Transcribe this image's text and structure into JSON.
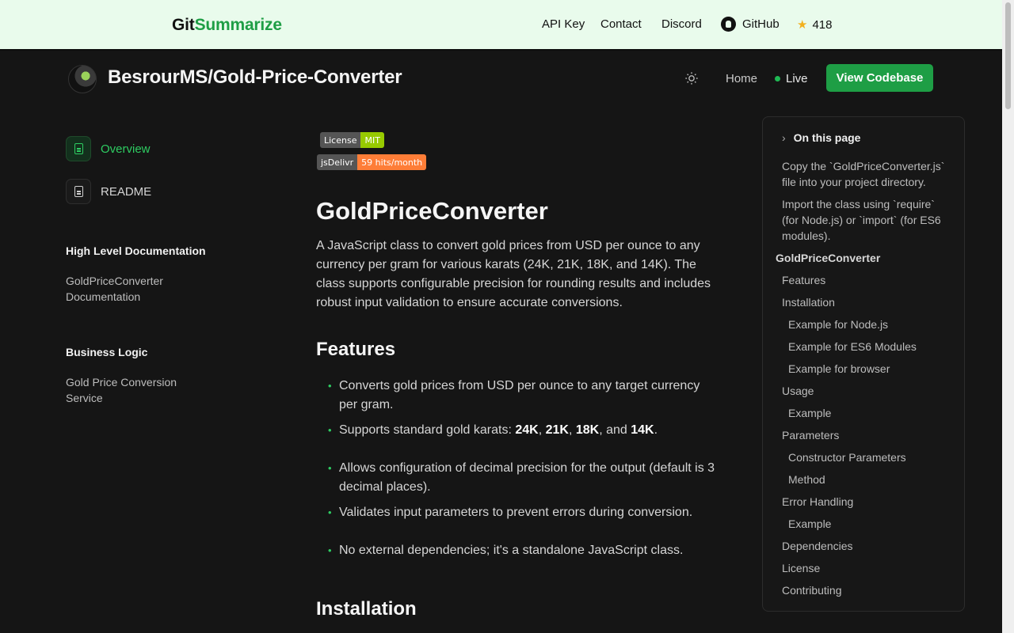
{
  "topbar": {
    "logo_part1": "Git",
    "logo_part2": "Summarize",
    "nav": {
      "api_key": "API Key",
      "contact": "Contact",
      "discord": "Discord",
      "github": "GitHub",
      "stars": "418"
    }
  },
  "header": {
    "repo_title": "BesrourMS/Gold-Price-Converter",
    "home": "Home",
    "live": "Live",
    "view_codebase": "View Codebase"
  },
  "sidebar": {
    "overview": "Overview",
    "readme": "README",
    "sections": [
      {
        "heading": "High Level Documentation",
        "link": "GoldPriceConverter Documentation"
      },
      {
        "heading": "Business Logic",
        "link": "Gold Price Conversion Service"
      }
    ]
  },
  "content": {
    "badges": [
      {
        "label": "License",
        "value": "MIT"
      },
      {
        "label": "jsDelivr",
        "value": "59 hits/month"
      }
    ],
    "title": "GoldPriceConverter",
    "intro": "A JavaScript class to convert gold prices from USD per ounce to any currency per gram for various karats (24K, 21K, 18K, and 14K). The class supports configurable precision for rounding results and includes robust input validation to ensure accurate conversions.",
    "features_heading": "Features",
    "features": {
      "f1": "Converts gold prices from USD per ounce to any target currency per gram.",
      "f2_prefix": "Supports standard gold karats: ",
      "f2_k1": "24K",
      "f2_k2": "21K",
      "f2_k3": "18K",
      "f2_and": ", and ",
      "f2_k4": "14K",
      "f3": "Allows configuration of decimal precision for the output (default is 3 decimal places).",
      "f4": "Validates input parameters to prevent errors during conversion.",
      "f5": "No external dependencies; it's a standalone JavaScript class."
    },
    "installation_heading": "Installation"
  },
  "toc": {
    "heading": "On this page",
    "items": [
      "Copy the `GoldPriceConverter.js` file into your project directory.",
      "Import the class using `require` (for Node.js) or `import` (for ES6 modules).",
      "GoldPriceConverter",
      "Features",
      "Installation",
      "Example for Node.js",
      "Example for ES6 Modules",
      "Example for browser",
      "Usage",
      "Example",
      "Parameters",
      "Constructor Parameters",
      "Method",
      "Error Handling",
      "Example",
      "Dependencies",
      "License",
      "Contributing"
    ]
  },
  "colors": {
    "accent": "#1e9e45",
    "topbar_bg": "#e9fbec",
    "page_bg": "#151515"
  }
}
